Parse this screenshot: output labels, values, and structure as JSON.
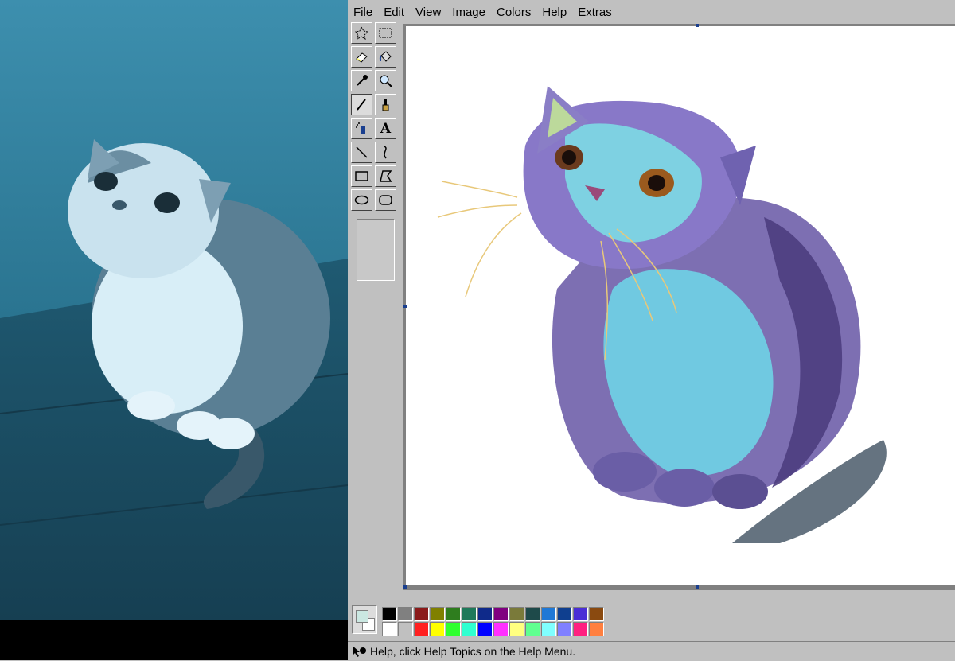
{
  "menu": {
    "items": [
      {
        "first": "F",
        "rest": "ile"
      },
      {
        "first": "E",
        "rest": "dit"
      },
      {
        "first": "V",
        "rest": "iew"
      },
      {
        "first": "I",
        "rest": "mage"
      },
      {
        "first": "C",
        "rest": "olors"
      },
      {
        "first": "H",
        "rest": "elp"
      },
      {
        "first": "E",
        "rest": "xtras"
      }
    ]
  },
  "tools": [
    {
      "name": "free-form-select-icon"
    },
    {
      "name": "rectangle-select-icon"
    },
    {
      "name": "eraser-icon"
    },
    {
      "name": "fill-bucket-icon"
    },
    {
      "name": "eyedropper-icon"
    },
    {
      "name": "magnifier-icon"
    },
    {
      "name": "pencil-icon",
      "selected": true
    },
    {
      "name": "brush-icon"
    },
    {
      "name": "airbrush-icon"
    },
    {
      "name": "text-icon",
      "glyph": "A"
    },
    {
      "name": "line-icon"
    },
    {
      "name": "curve-icon"
    },
    {
      "name": "rectangle-icon"
    },
    {
      "name": "polygon-icon"
    },
    {
      "name": "ellipse-icon"
    },
    {
      "name": "rounded-rectangle-icon"
    }
  ],
  "colors": {
    "foreground": "#cbe8e2",
    "background": "#ffffff",
    "palette_row1": [
      "#000000",
      "#808080",
      "#8b1a1a",
      "#808000",
      "#2e7d1e",
      "#1e7a5a",
      "#0f2a8a",
      "#800080",
      "#7a7a3a",
      "#1e4a4a",
      "#1f78d6",
      "#0f3f8f",
      "#4a2ed6",
      "#8a4a10"
    ],
    "palette_row2": [
      "#ffffff",
      "#c0c0c0",
      "#ff2020",
      "#ffff00",
      "#30ff30",
      "#30ffd0",
      "#0000ff",
      "#ff30ff",
      "#ffff80",
      "#60ff90",
      "#80ffff",
      "#8080ff",
      "#ff2080",
      "#ff8040"
    ]
  },
  "status": {
    "text": "Help, click Help Topics on the Help Menu."
  }
}
